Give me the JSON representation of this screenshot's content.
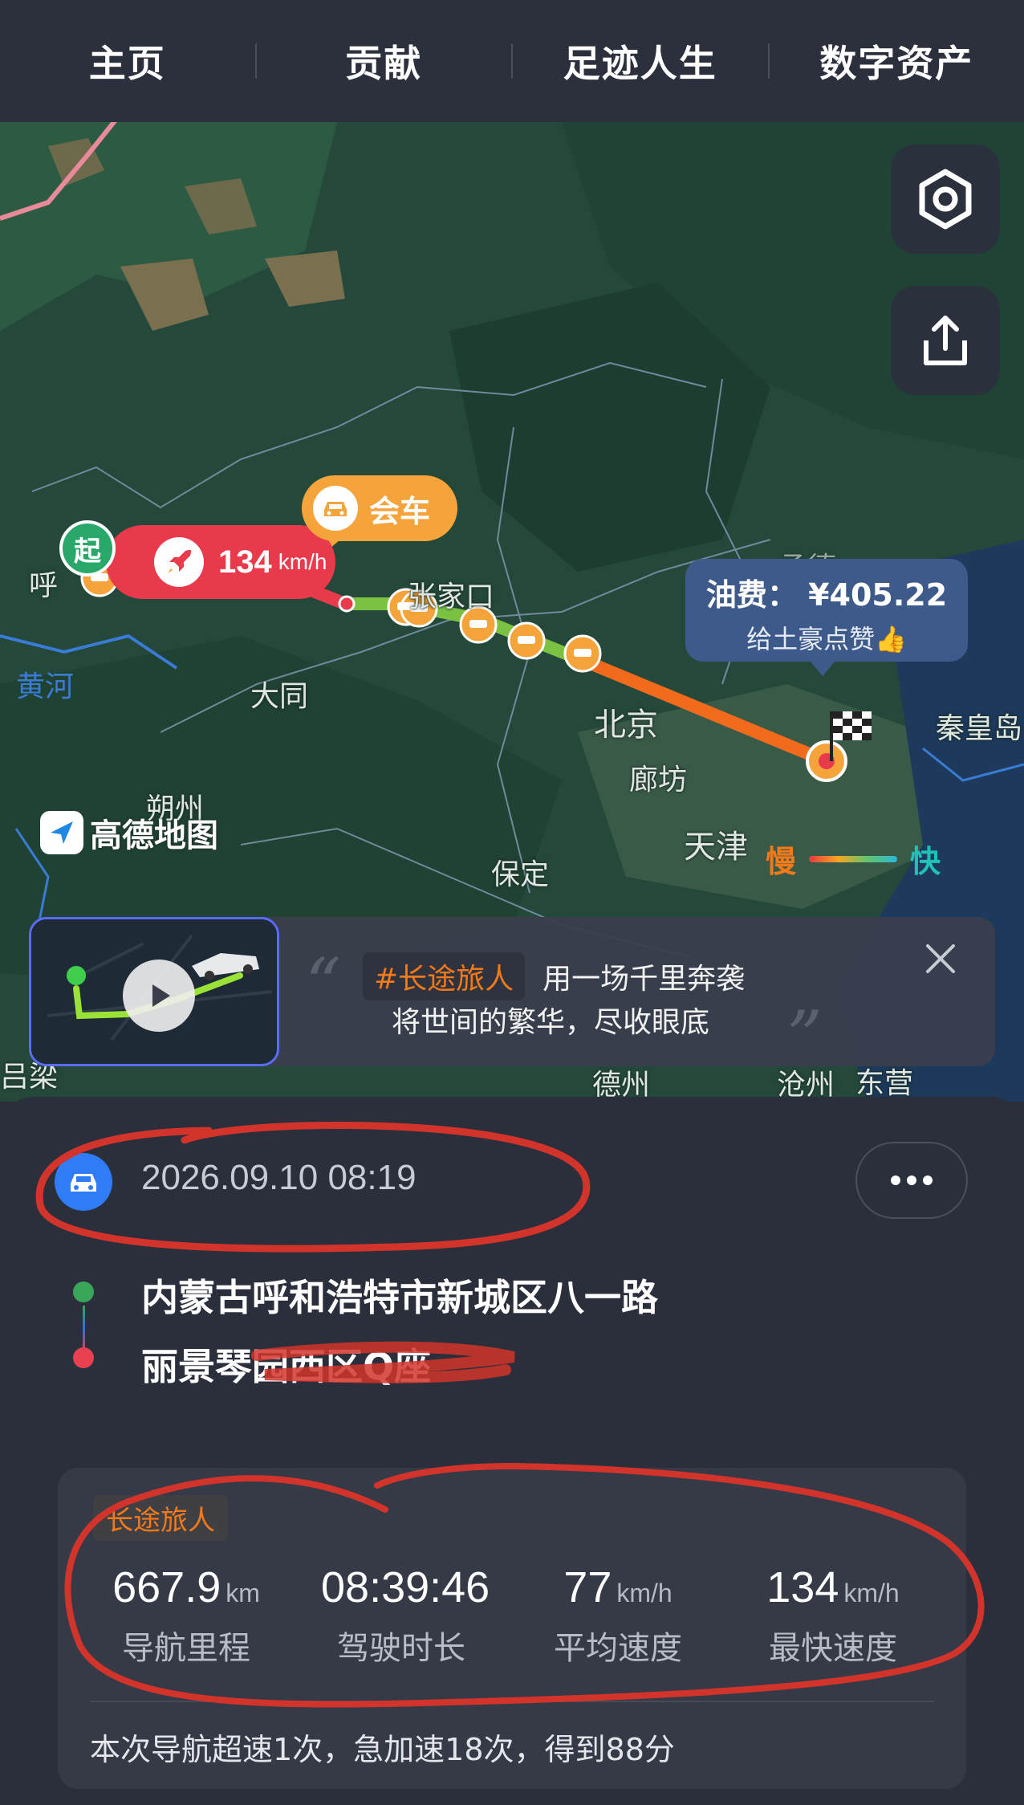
{
  "tabs": [
    "主页",
    "贡献",
    "足迹人生",
    "数字资产"
  ],
  "map": {
    "places": {
      "hohhot": "呼",
      "yellow_river": "黄河",
      "datong": "大同",
      "zhangjiakou": "张家口",
      "beijing": "北京",
      "langfang": "廊坊",
      "tianjin": "天津",
      "baoding": "保定",
      "shuozhou": "朔州",
      "qinhuangdao": "秦皇岛",
      "chengde": "承德",
      "dezhou": "德州",
      "cangzhou": "沧州",
      "dongying": "东营",
      "lvliang": "吕梁"
    },
    "start_label": "起",
    "speed_value": "134",
    "speed_unit": "km/h",
    "meet_label": "会车",
    "fuel_line": "油费： ¥405.22",
    "fuel_sub": "给土豪点赞👍",
    "logo_text": "高德地图",
    "legend_slow": "慢",
    "legend_fast": "快",
    "icons": [
      "settings-icon",
      "share-icon",
      "rocket-icon",
      "car-icon",
      "finish-flag-icon",
      "close-icon",
      "play-icon"
    ]
  },
  "promo": {
    "tag": "#长途旅人",
    "line1": "用一场千里奔袭",
    "line2": "将世间的繁华，尽收眼底"
  },
  "trip": {
    "datetime": "2026.09.10 08:19",
    "from": "内蒙古呼和浩特市新城区八一路",
    "to": "丽景琴园西区Q座",
    "tag": "长途旅人",
    "stats": [
      {
        "value": "667.9",
        "unit": "km",
        "label": "导航里程"
      },
      {
        "value": "08:39:46",
        "unit": "",
        "label": "驾驶时长"
      },
      {
        "value": "77",
        "unit": "km/h",
        "label": "平均速度"
      },
      {
        "value": "134",
        "unit": "km/h",
        "label": "最快速度"
      }
    ],
    "summary": "本次导航超速1次，急加速18次，得到88分"
  },
  "colors": {
    "topbar": "#2c303d",
    "speed_bubble": "#e83a4a",
    "meet_bubble": "#f5a43c",
    "fuel_bubble": "#3e5a8a",
    "accent_orange": "#f27a1a",
    "route_green": "#7cc242",
    "route_orange": "#f26b1d"
  }
}
